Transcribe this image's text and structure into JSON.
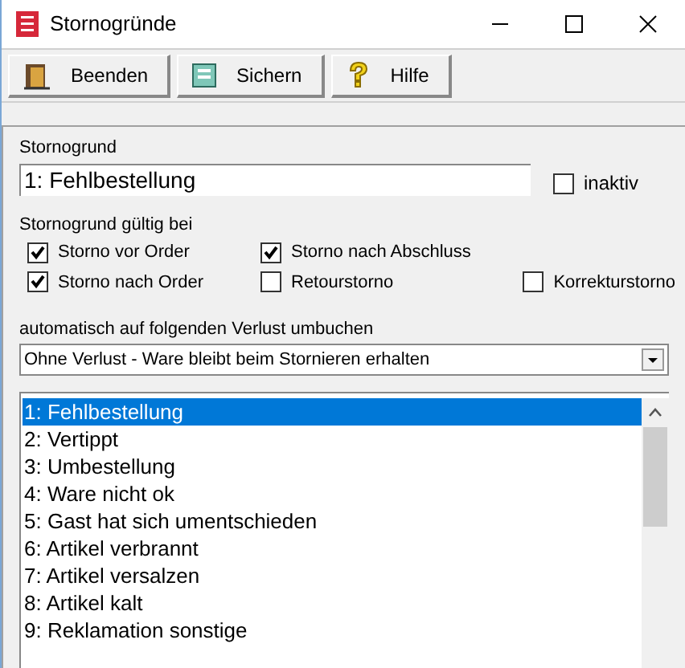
{
  "window": {
    "title": "Stornogründe"
  },
  "toolbar": [
    {
      "kind": "exit",
      "label": "Beenden"
    },
    {
      "kind": "save",
      "label": "Sichern"
    },
    {
      "kind": "help",
      "label": "Hilfe"
    }
  ],
  "reason": {
    "label": "Stornogrund",
    "value": "1: Fehlbestellung",
    "inactive": {
      "label": "inaktiv",
      "checked": false
    }
  },
  "valid_for": {
    "label": "Stornogrund gültig bei",
    "options": [
      {
        "label": "Storno vor Order",
        "checked": true
      },
      {
        "label": "Storno nach Abschluss",
        "checked": true
      },
      {
        "label": "Storno nach Order",
        "checked": true
      },
      {
        "label": "Retourstorno",
        "checked": false
      },
      {
        "label": "Korrekturstorno",
        "checked": false
      }
    ]
  },
  "loss": {
    "label": "automatisch auf folgenden Verlust umbuchen",
    "value": "Ohne Verlust - Ware bleibt beim Stornieren erhalten"
  },
  "list": [
    {
      "label": "1: Fehlbestellung",
      "selected": true
    },
    {
      "label": "2: Vertippt",
      "selected": false
    },
    {
      "label": "3: Umbestellung",
      "selected": false
    },
    {
      "label": "4: Ware nicht ok",
      "selected": false
    },
    {
      "label": "5: Gast hat sich umentschieden",
      "selected": false
    },
    {
      "label": "6: Artikel verbrannt",
      "selected": false
    },
    {
      "label": "7: Artikel versalzen",
      "selected": false
    },
    {
      "label": "8: Artikel kalt",
      "selected": false
    },
    {
      "label": "9: Reklamation sonstige",
      "selected": false
    }
  ]
}
